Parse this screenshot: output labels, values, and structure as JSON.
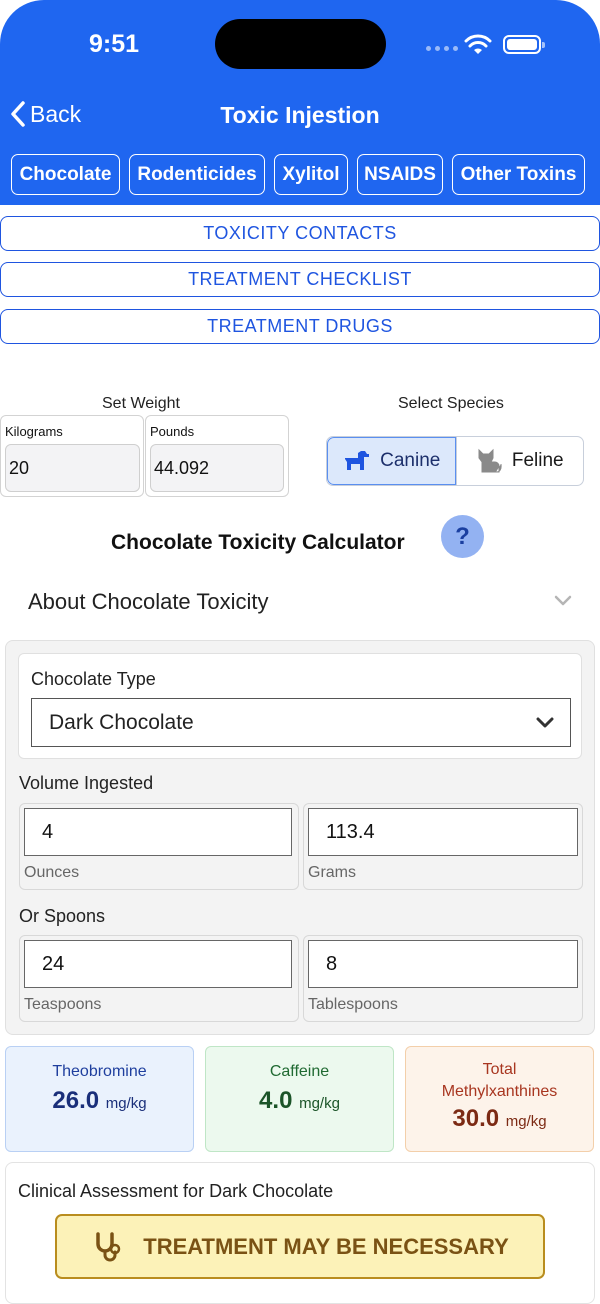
{
  "status_bar": {
    "time": "9:51"
  },
  "nav": {
    "back_label": "Back",
    "title": "Toxic Injestion"
  },
  "tabs": [
    {
      "label": "Chocolate"
    },
    {
      "label": "Rodenticides"
    },
    {
      "label": "Xylitol"
    },
    {
      "label": "NSAIDS"
    },
    {
      "label": "Other Toxins"
    }
  ],
  "links": {
    "contacts": "TOXICITY CONTACTS",
    "checklist": "TREATMENT CHECKLIST",
    "drugs": "TREATMENT DRUGS"
  },
  "weight": {
    "label": "Set Weight",
    "kg_label": "Kilograms",
    "kg_value": "20",
    "lb_label": "Pounds",
    "lb_value": "44.092"
  },
  "species": {
    "label": "Select Species",
    "options": [
      "Canine",
      "Feline"
    ],
    "selected": "Canine"
  },
  "calculator": {
    "title": "Chocolate Toxicity Calculator",
    "help_symbol": "?",
    "about_label": "About Chocolate Toxicity",
    "type_label": "Chocolate Type",
    "type_value": "Dark Chocolate",
    "volume_label": "Volume Ingested",
    "ounces_value": "4",
    "ounces_label": "Ounces",
    "grams_value": "113.4",
    "grams_label": "Grams",
    "spoons_label": "Or Spoons",
    "teaspoons_value": "24",
    "teaspoons_label": "Teaspoons",
    "tablespoons_value": "8",
    "tablespoons_label": "Tablespoons"
  },
  "results": {
    "theobromine": {
      "name": "Theobromine",
      "value": "26.0",
      "unit": "mg/kg"
    },
    "caffeine": {
      "name": "Caffeine",
      "value": "4.0",
      "unit": "mg/kg"
    },
    "total": {
      "name_line1": "Total",
      "name_line2": "Methylxanthines",
      "value": "30.0",
      "unit": "mg/kg"
    }
  },
  "assessment": {
    "title": "Clinical Assessment for Dark Chocolate",
    "alert": "TREATMENT MAY BE NECESSARY"
  },
  "colors": {
    "header_blue": "#1f66f0",
    "link_blue": "#1f55e0",
    "alert_bg": "#fcf2b8",
    "alert_border": "#b98d1e"
  }
}
